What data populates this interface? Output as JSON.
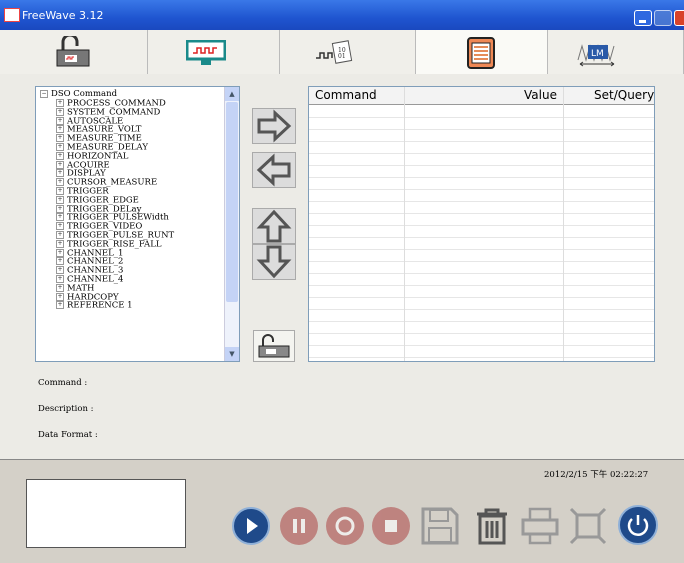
{
  "window": {
    "title": "FreeWave 3.12"
  },
  "tree": {
    "root": "DSO Command",
    "items": [
      "PROCESS_COMMAND",
      "SYSTEM_COMMAND",
      "AUTOSCALE",
      "MEASURE_VOLT",
      "MEASURE_TIME",
      "MEASURE_DELAY",
      "HORIZONTAL",
      "ACQUIRE",
      "DISPLAY",
      "CURSOR_MEASURE",
      "TRIGGER",
      "TRIGGER_EDGE",
      "TRIGGER_DELay",
      "TRIGGER_PULSEWidth",
      "TRIGGER_VIDEO",
      "TRIGGER_PULSE_RUNT",
      "TRIGGER_RISE_FALL",
      "CHANNEL_1",
      "CHANNEL_2",
      "CHANNEL_3",
      "CHANNEL_4",
      "MATH",
      "HARDCOPY",
      "REFERENCE 1"
    ]
  },
  "grid": {
    "columns": [
      "Command",
      "Value",
      "Set/Query"
    ]
  },
  "info": {
    "command_label": "Command :",
    "description_label": "Description :",
    "data_format_label": "Data Format :"
  },
  "status": {
    "datetime": "2012/2/15 下午 02:22:27"
  },
  "toolbar": {
    "tab_icons": [
      "connect-icon",
      "scope-display-icon",
      "waveform-data-icon",
      "command-list-icon",
      "lm-meter-icon"
    ]
  },
  "colors": {
    "titlebar": "#1f55d0",
    "accent_blue": "#1f4a8a"
  }
}
